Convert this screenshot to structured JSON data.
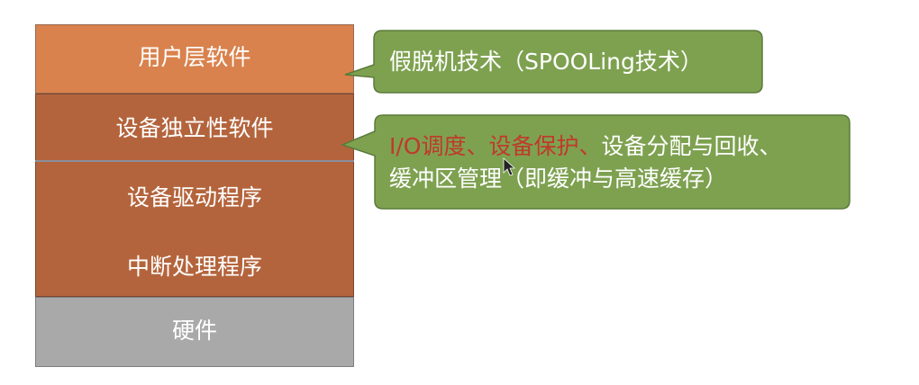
{
  "layers": {
    "user": "用户层软件",
    "device_independent": "设备独立性软件",
    "driver": "设备驱动程序",
    "interrupt": "中断处理程序",
    "hardware": "硬件"
  },
  "callout1": {
    "text": "假脱机技术（SPOOLing技术）"
  },
  "callout2": {
    "highlight1": "I/O调度、",
    "highlight2": "设备保护、",
    "rest1": "设备分配与回收、",
    "line2": "缓冲区管理（即缓冲与高速缓存）"
  },
  "colors": {
    "user_layer": "#d9824d",
    "os_layer": "#b4643c",
    "hardware_layer": "#a9a9a9",
    "callout_fill": "#7ea150",
    "callout_border": "#5a7a3a",
    "highlight_text": "#c0392b"
  },
  "icons": {
    "cursor": "mouse-pointer-icon"
  }
}
